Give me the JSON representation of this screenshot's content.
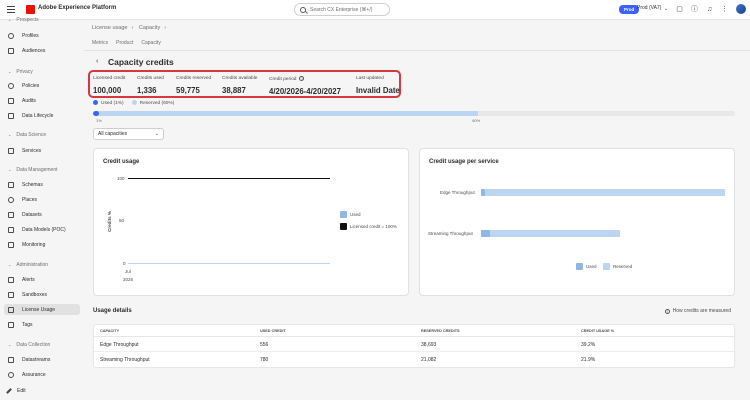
{
  "header": {
    "app_title": "Adobe Experience Platform",
    "search_placeholder": "Search CX Enterprise (⌘+/)",
    "env_badge": "Prod",
    "env_name": "Prod (VA7)"
  },
  "sidebar": {
    "sections": [
      {
        "label": "Prospects",
        "items": [
          {
            "label": "Profiles"
          },
          {
            "label": "Audiences"
          }
        ]
      },
      {
        "label": "Privacy",
        "items": [
          {
            "label": "Policies"
          },
          {
            "label": "Audits"
          },
          {
            "label": "Data Lifecycle"
          }
        ]
      },
      {
        "label": "Data Science",
        "items": [
          {
            "label": "Services"
          }
        ]
      },
      {
        "label": "Data Management",
        "items": [
          {
            "label": "Schemas"
          },
          {
            "label": "Places"
          },
          {
            "label": "Datasets"
          },
          {
            "label": "Data Models (POC)"
          },
          {
            "label": "Monitoring"
          }
        ]
      },
      {
        "label": "Administration",
        "items": [
          {
            "label": "Alerts"
          },
          {
            "label": "Sandboxes"
          },
          {
            "label": "License Usage"
          },
          {
            "label": "Tags"
          }
        ]
      },
      {
        "label": "Data Collection",
        "items": [
          {
            "label": "Datastreams"
          },
          {
            "label": "Assurance"
          }
        ]
      }
    ],
    "edit_label": "Edit"
  },
  "breadcrumb": [
    "License usage",
    "Capacity"
  ],
  "subnav": [
    "Metrics",
    "Product",
    "Capacity"
  ],
  "page_title": "Capacity credits",
  "stats": [
    {
      "label": "Licensed credit",
      "value": "100,000"
    },
    {
      "label": "Credits used",
      "value": "1,336"
    },
    {
      "label": "Credits reserved",
      "value": "59,775"
    },
    {
      "label": "Credits available",
      "value": "38,887"
    },
    {
      "label": "Credit period",
      "value": "4/20/2026-4/20/2027"
    },
    {
      "label": "Last updated",
      "value": "Invalid Date"
    }
  ],
  "overall_bar": {
    "used_label": "Used (1%)",
    "reserved_label": "Reserved (60%)",
    "used_fraction": 0.01,
    "reserved_fraction": 0.6,
    "start_label": "1%",
    "end_label": "60%",
    "colors": {
      "used": "#3b63fb",
      "reserved": "#bcd5f2"
    }
  },
  "filter": {
    "selected": "All capacities"
  },
  "credit_usage_card": {
    "title": "Credit usage",
    "ylabel": "Credits %",
    "yticks": [
      "100",
      "50",
      "0"
    ],
    "xtick_month": "Jul",
    "xtick_year": "2026",
    "legend_used": "Used",
    "legend_licensed": "Licensed credit = 100%"
  },
  "per_service_card": {
    "title": "Credit usage per service",
    "services": [
      {
        "name": "Edge Throughput",
        "used_pct": 1.4,
        "reserved_pct": 100
      },
      {
        "name": "Streaming Throughput",
        "used_pct": 3.7,
        "reserved_pct": 57
      }
    ],
    "legend_used": "Used",
    "legend_reserved": "Reserved"
  },
  "usage_details": {
    "title": "Usage details",
    "help_link": "How credits are measured",
    "columns": [
      "Capacity",
      "Used credit",
      "Reserved credits",
      "Credit usage %"
    ],
    "rows": [
      [
        "Edge Throughput",
        "556",
        "38,693",
        "39.2%"
      ],
      [
        "Streaming Throughput",
        "780",
        "21,082",
        "21.9%"
      ]
    ]
  },
  "chart_data": [
    {
      "type": "line",
      "title": "Credit usage",
      "xlabel": "",
      "ylabel": "Credits %",
      "ylim": [
        0,
        100
      ],
      "categories": [
        "Jul 2026"
      ],
      "series": [
        {
          "name": "Used",
          "values": [
            1
          ]
        },
        {
          "name": "Licensed credit = 100%",
          "values": [
            100
          ]
        }
      ]
    },
    {
      "type": "bar",
      "title": "Credit usage per service",
      "categories": [
        "Edge Throughput",
        "Streaming Throughput"
      ],
      "series": [
        {
          "name": "Used",
          "values": [
            556,
            780
          ]
        },
        {
          "name": "Reserved",
          "values": [
            38693,
            21082
          ]
        }
      ]
    }
  ]
}
